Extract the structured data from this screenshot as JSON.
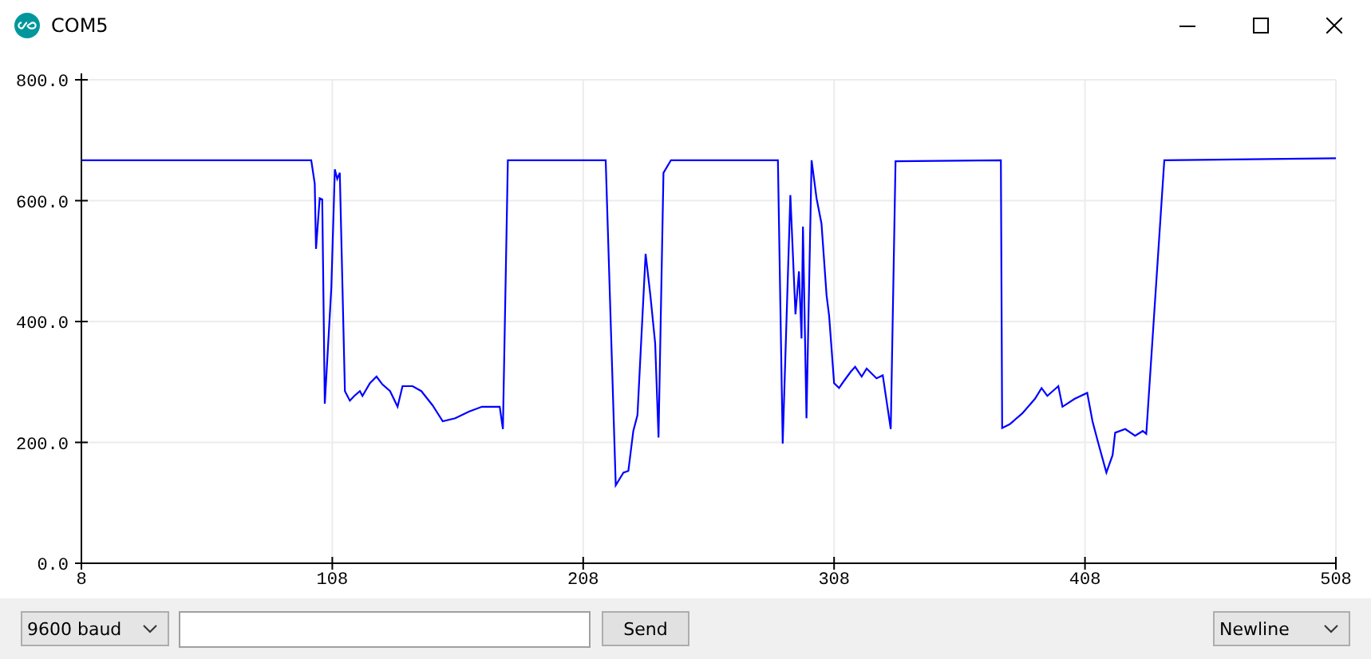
{
  "window": {
    "title": "COM5"
  },
  "plot": {
    "chart_data": {
      "type": "line",
      "grid": true,
      "xlim": [
        8,
        508
      ],
      "ylim": [
        0,
        800
      ],
      "xticks": [
        8,
        108,
        208,
        308,
        408,
        508
      ],
      "yticks": [
        {
          "value": 0,
          "label": "0.0"
        },
        {
          "value": 200,
          "label": "200.0"
        },
        {
          "value": 400,
          "label": "400.0"
        },
        {
          "value": 600,
          "label": "600.0"
        },
        {
          "value": 800,
          "label": "800.0"
        }
      ],
      "x": [
        8,
        99.6,
        101,
        101.5,
        103,
        104,
        105,
        107.6,
        109,
        110,
        111,
        113,
        115,
        116.8,
        119,
        120,
        123,
        125.6,
        128,
        131,
        134,
        136,
        140,
        143.5,
        148,
        152,
        157,
        162.6,
        167.7,
        174.7,
        176,
        178,
        217,
        221,
        224,
        226,
        228,
        229.6,
        232.9,
        234.8,
        236.7,
        238,
        240,
        243,
        285.6,
        287.5,
        290.6,
        292.6,
        294,
        295,
        295.6,
        297,
        299,
        301,
        303,
        305,
        306,
        308,
        310,
        311.8,
        314.7,
        316.4,
        319,
        321,
        324.9,
        327.4,
        330.6,
        332.5,
        374.5,
        375,
        378,
        383,
        388,
        390.7,
        393,
        397.4,
        399,
        403.8,
        408.9,
        411,
        413,
        416.5,
        419,
        420,
        424,
        428,
        431,
        432.4,
        439.6,
        508
      ],
      "series": [
        {
          "color": "#0000ff",
          "values": [
            667,
            667,
            628,
            520,
            604,
            602,
            264,
            456,
            652,
            636,
            646,
            285,
            269,
            277,
            285,
            277,
            298,
            309,
            296,
            285,
            259,
            293,
            293,
            285,
            261,
            235,
            240,
            251,
            259,
            259,
            222,
            667,
            667,
            129,
            150,
            153,
            219,
            245,
            512,
            443,
            364,
            208,
            646,
            667,
            667,
            198,
            609,
            412,
            483,
            372,
            557,
            240,
            667,
            604,
            562,
            443,
            409,
            298,
            290,
            301,
            317,
            325,
            309,
            322,
            306,
            311,
            222,
            665,
            667,
            224,
            230,
            248,
            272,
            290,
            277,
            293,
            259,
            272,
            282,
            235,
            203,
            150,
            179,
            216,
            222,
            211,
            219,
            214,
            667,
            670
          ]
        }
      ]
    }
  },
  "controls": {
    "baud": "9600 baud",
    "send": "Send",
    "line_ending": "Newline"
  }
}
